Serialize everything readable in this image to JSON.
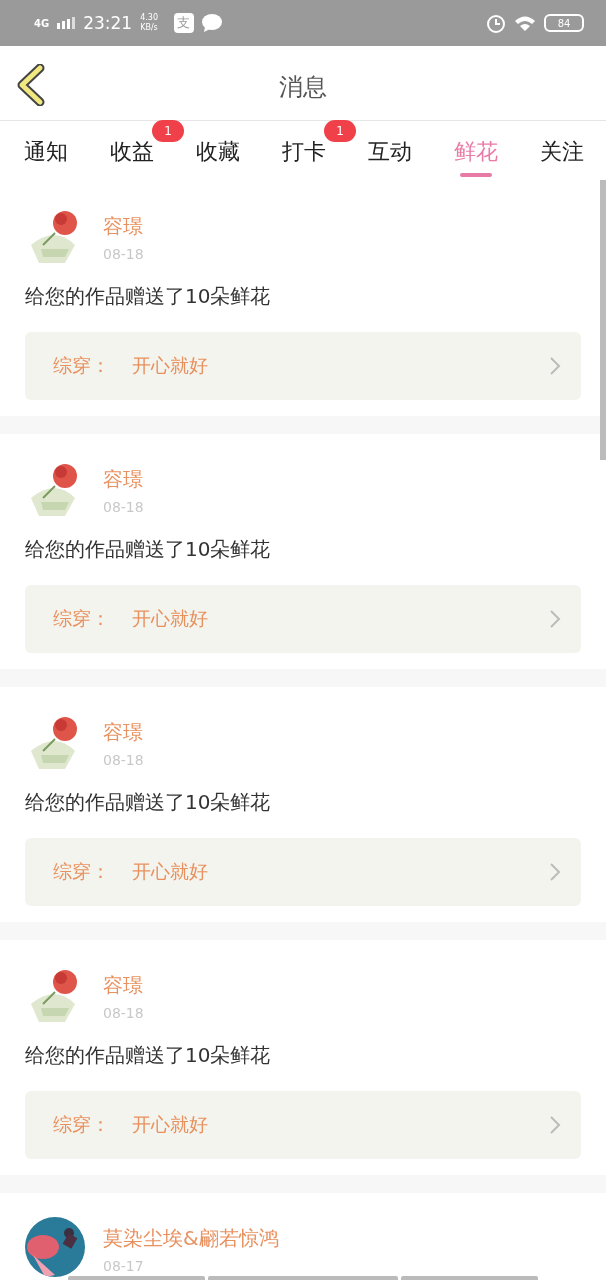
{
  "status_bar": {
    "network": "4G",
    "time": "23:21",
    "speed": "4.30",
    "speed_unit": "KB/s",
    "app_badge": "支",
    "battery": "84"
  },
  "header": {
    "title": "消息"
  },
  "tabs": [
    {
      "label": "通知",
      "selected": false
    },
    {
      "label": "收益",
      "selected": false,
      "badge": "1"
    },
    {
      "label": "收藏",
      "selected": false
    },
    {
      "label": "打卡",
      "selected": false,
      "badge": "1"
    },
    {
      "label": "互动",
      "selected": false
    },
    {
      "label": "鲜花",
      "selected": true
    },
    {
      "label": "关注",
      "selected": false
    }
  ],
  "messages": [
    {
      "name": "容璟",
      "date": "08-18",
      "text": "给您的作品赠送了10朵鲜花",
      "quote_label": "综穿：",
      "quote_title": "开心就好"
    },
    {
      "name": "容璟",
      "date": "08-18",
      "text": "给您的作品赠送了10朵鲜花",
      "quote_label": "综穿：",
      "quote_title": "开心就好"
    },
    {
      "name": "容璟",
      "date": "08-18",
      "text": "给您的作品赠送了10朵鲜花",
      "quote_label": "综穿：",
      "quote_title": "开心就好"
    },
    {
      "name": "容璟",
      "date": "08-18",
      "text": "给您的作品赠送了10朵鲜花",
      "quote_label": "综穿：",
      "quote_title": "开心就好"
    },
    {
      "name": "莫染尘埃&翩若惊鸿",
      "date": "08-17"
    }
  ]
}
